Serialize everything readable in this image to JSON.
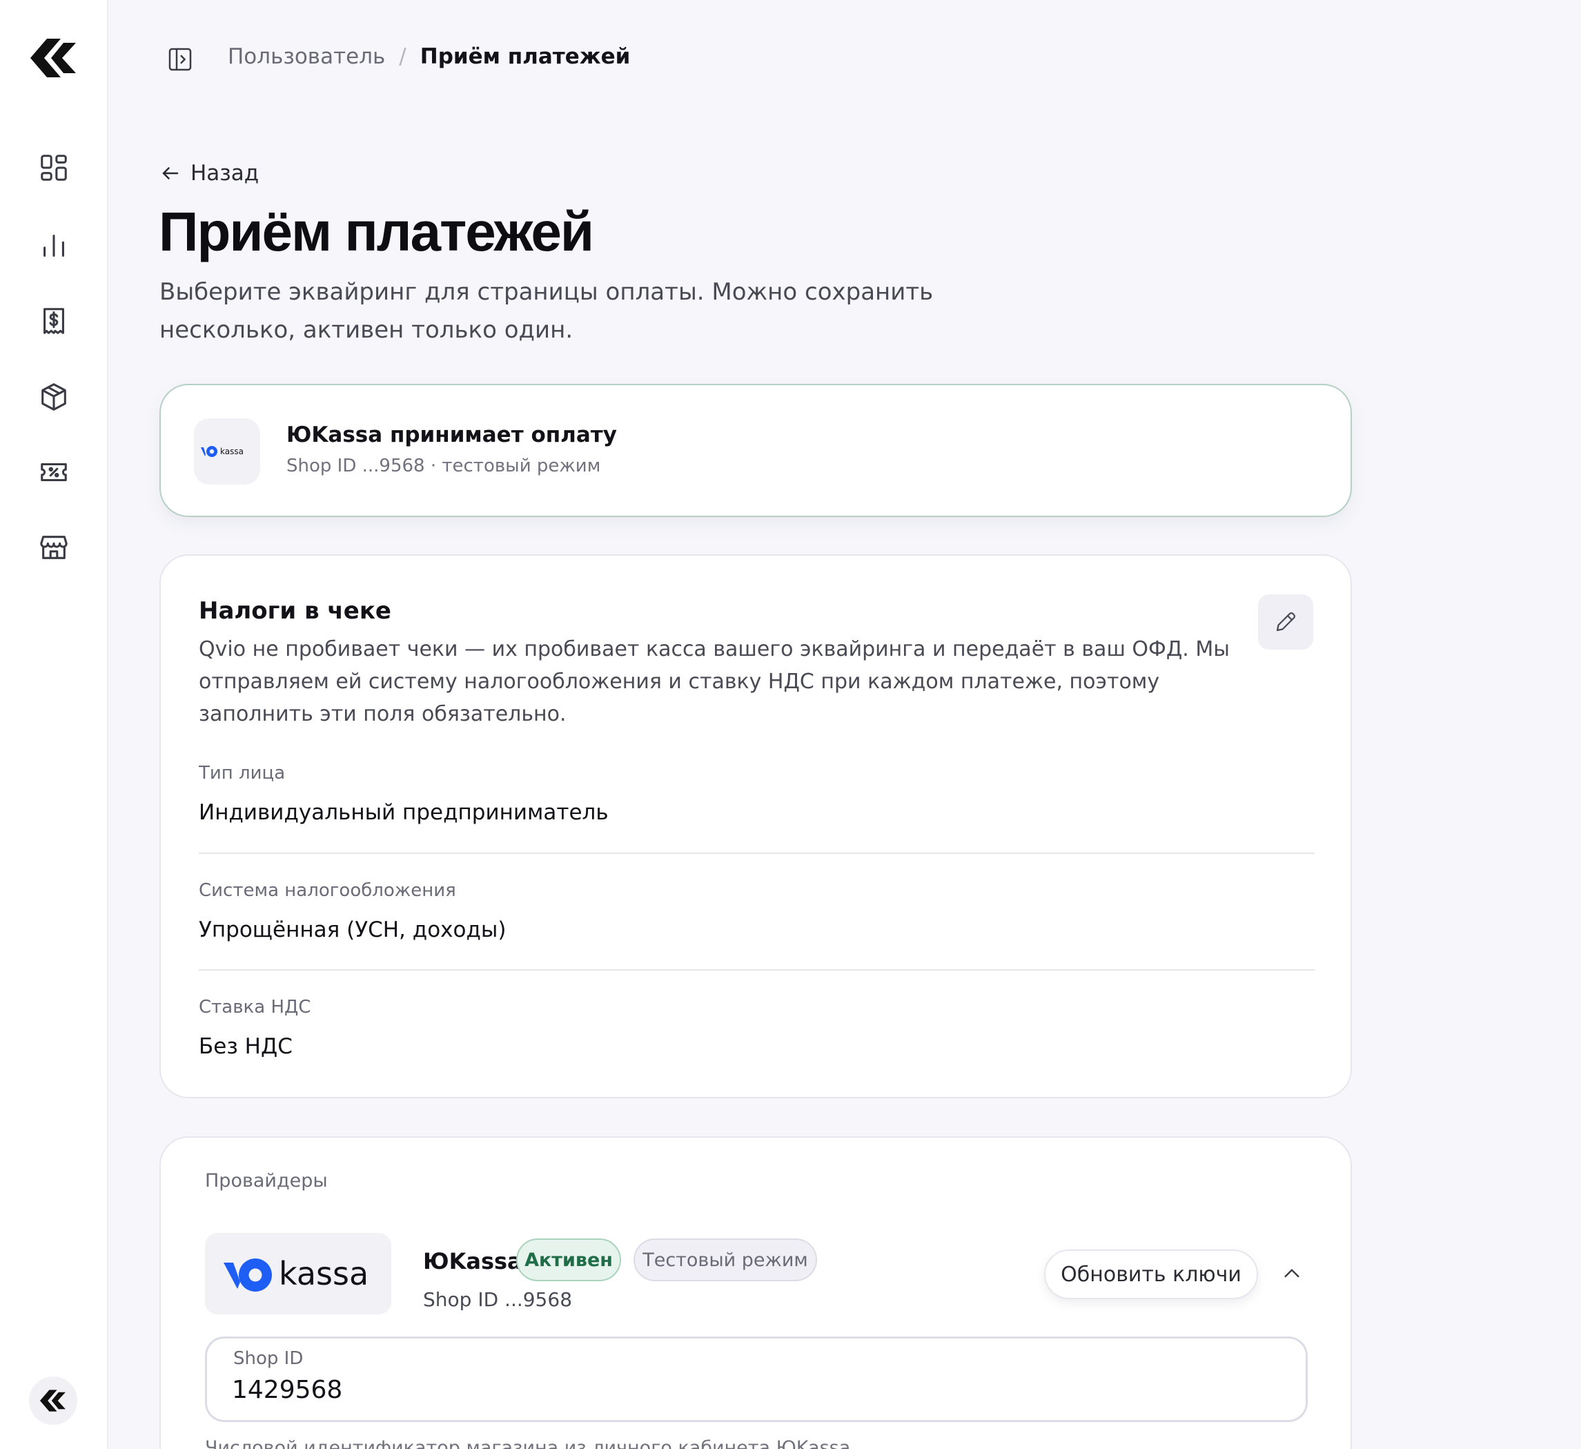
{
  "breadcrumb": {
    "parent": "Пользователь",
    "separator": "/",
    "current": "Приём платежей"
  },
  "page": {
    "back_label": "Назад",
    "title": "Приём платежей",
    "subtitle": "Выберите эквайринг для страницы оплаты. Можно сохранить несколько, активен только один."
  },
  "status_card": {
    "title": "ЮKassa принимает оплату",
    "subtitle": "Shop ID ...9568 · тестовый режим",
    "logo_text": "kassa"
  },
  "tax_card": {
    "title": "Налоги в чеке",
    "description": "Qvio не пробивает чеки — их пробивает касса вашего эквайринга и передаёт в ваш ОФД. Мы отправляем ей систему налогообложения и ставку НДС при каждом платеже, поэтому заполнить эти поля обязательно.",
    "fields": [
      {
        "label": "Тип лица",
        "value": "Индивидуальный предприниматель"
      },
      {
        "label": "Система налогообложения",
        "value": "Упрощённая (УСН, доходы)"
      },
      {
        "label": "Ставка НДС",
        "value": "Без НДС"
      }
    ]
  },
  "providers": {
    "heading": "Провайдеры",
    "item": {
      "logo_text": "kassa",
      "name": "ЮKassa",
      "badge_active": "Активен",
      "badge_test": "Тестовый режим",
      "shop_short": "Shop ID ...9568",
      "refresh_label": "Обновить ключи",
      "shop_id_label": "Shop ID",
      "shop_id_value": "1429568",
      "shop_id_hint": "Числовой идентификатор магазина из личного кабинета ЮKassa"
    }
  },
  "colors": {
    "accent_blue": "#1f5ef5",
    "active_green": "#1f6e47",
    "active_border": "#b6d0c6"
  },
  "icons": {
    "sidebar": [
      "dashboard-icon",
      "chart-icon",
      "receipt-icon",
      "box-icon",
      "ticket-icon",
      "store-icon"
    ]
  }
}
